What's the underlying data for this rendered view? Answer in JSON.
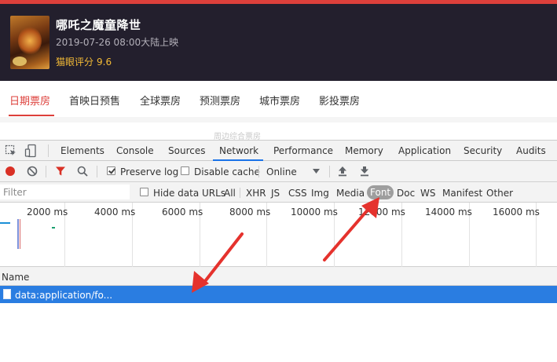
{
  "movie": {
    "title": "哪吒之魔童降世",
    "release": "2019-07-26 08:00大陆上映",
    "score_label": "猫眼评分",
    "score": "9.6"
  },
  "site_tabs": [
    {
      "label": "日期票房",
      "active": true
    },
    {
      "label": "首映日预售",
      "active": false
    },
    {
      "label": "全球票房",
      "active": false
    },
    {
      "label": "预测票房",
      "active": false
    },
    {
      "label": "城市票房",
      "active": false
    },
    {
      "label": "影投票房",
      "active": false
    }
  ],
  "partial_text": "周边综合票房",
  "devtools": {
    "panels": [
      "Elements",
      "Console",
      "Sources",
      "Network",
      "Performance",
      "Memory",
      "Application",
      "Security",
      "Audits"
    ],
    "active_panel": "Network",
    "toolbar": {
      "preserve_log": "Preserve log",
      "disable_cache": "Disable cache",
      "throttle": "Online",
      "preserve_log_checked": true,
      "disable_cache_checked": false
    },
    "filter": {
      "placeholder": "Filter",
      "hide_data_urls": "Hide data URLs",
      "types": [
        "All",
        "XHR",
        "JS",
        "CSS",
        "Img",
        "Media",
        "Font",
        "Doc",
        "WS",
        "Manifest",
        "Other"
      ],
      "selected_type": "Font"
    },
    "timeline_ticks": [
      "2000 ms",
      "4000 ms",
      "6000 ms",
      "8000 ms",
      "10000 ms",
      "12000 ms",
      "14000 ms",
      "16000 ms"
    ],
    "columns": {
      "name": "Name"
    },
    "requests": [
      {
        "name": "data:application/fo...",
        "selected": true
      }
    ]
  },
  "colors": {
    "brand_red": "#dd403b",
    "header_bg": "#231f2d",
    "score_yellow": "#f4bb36",
    "selection_blue": "#2a7de1",
    "annotation_red": "#e5322d"
  }
}
